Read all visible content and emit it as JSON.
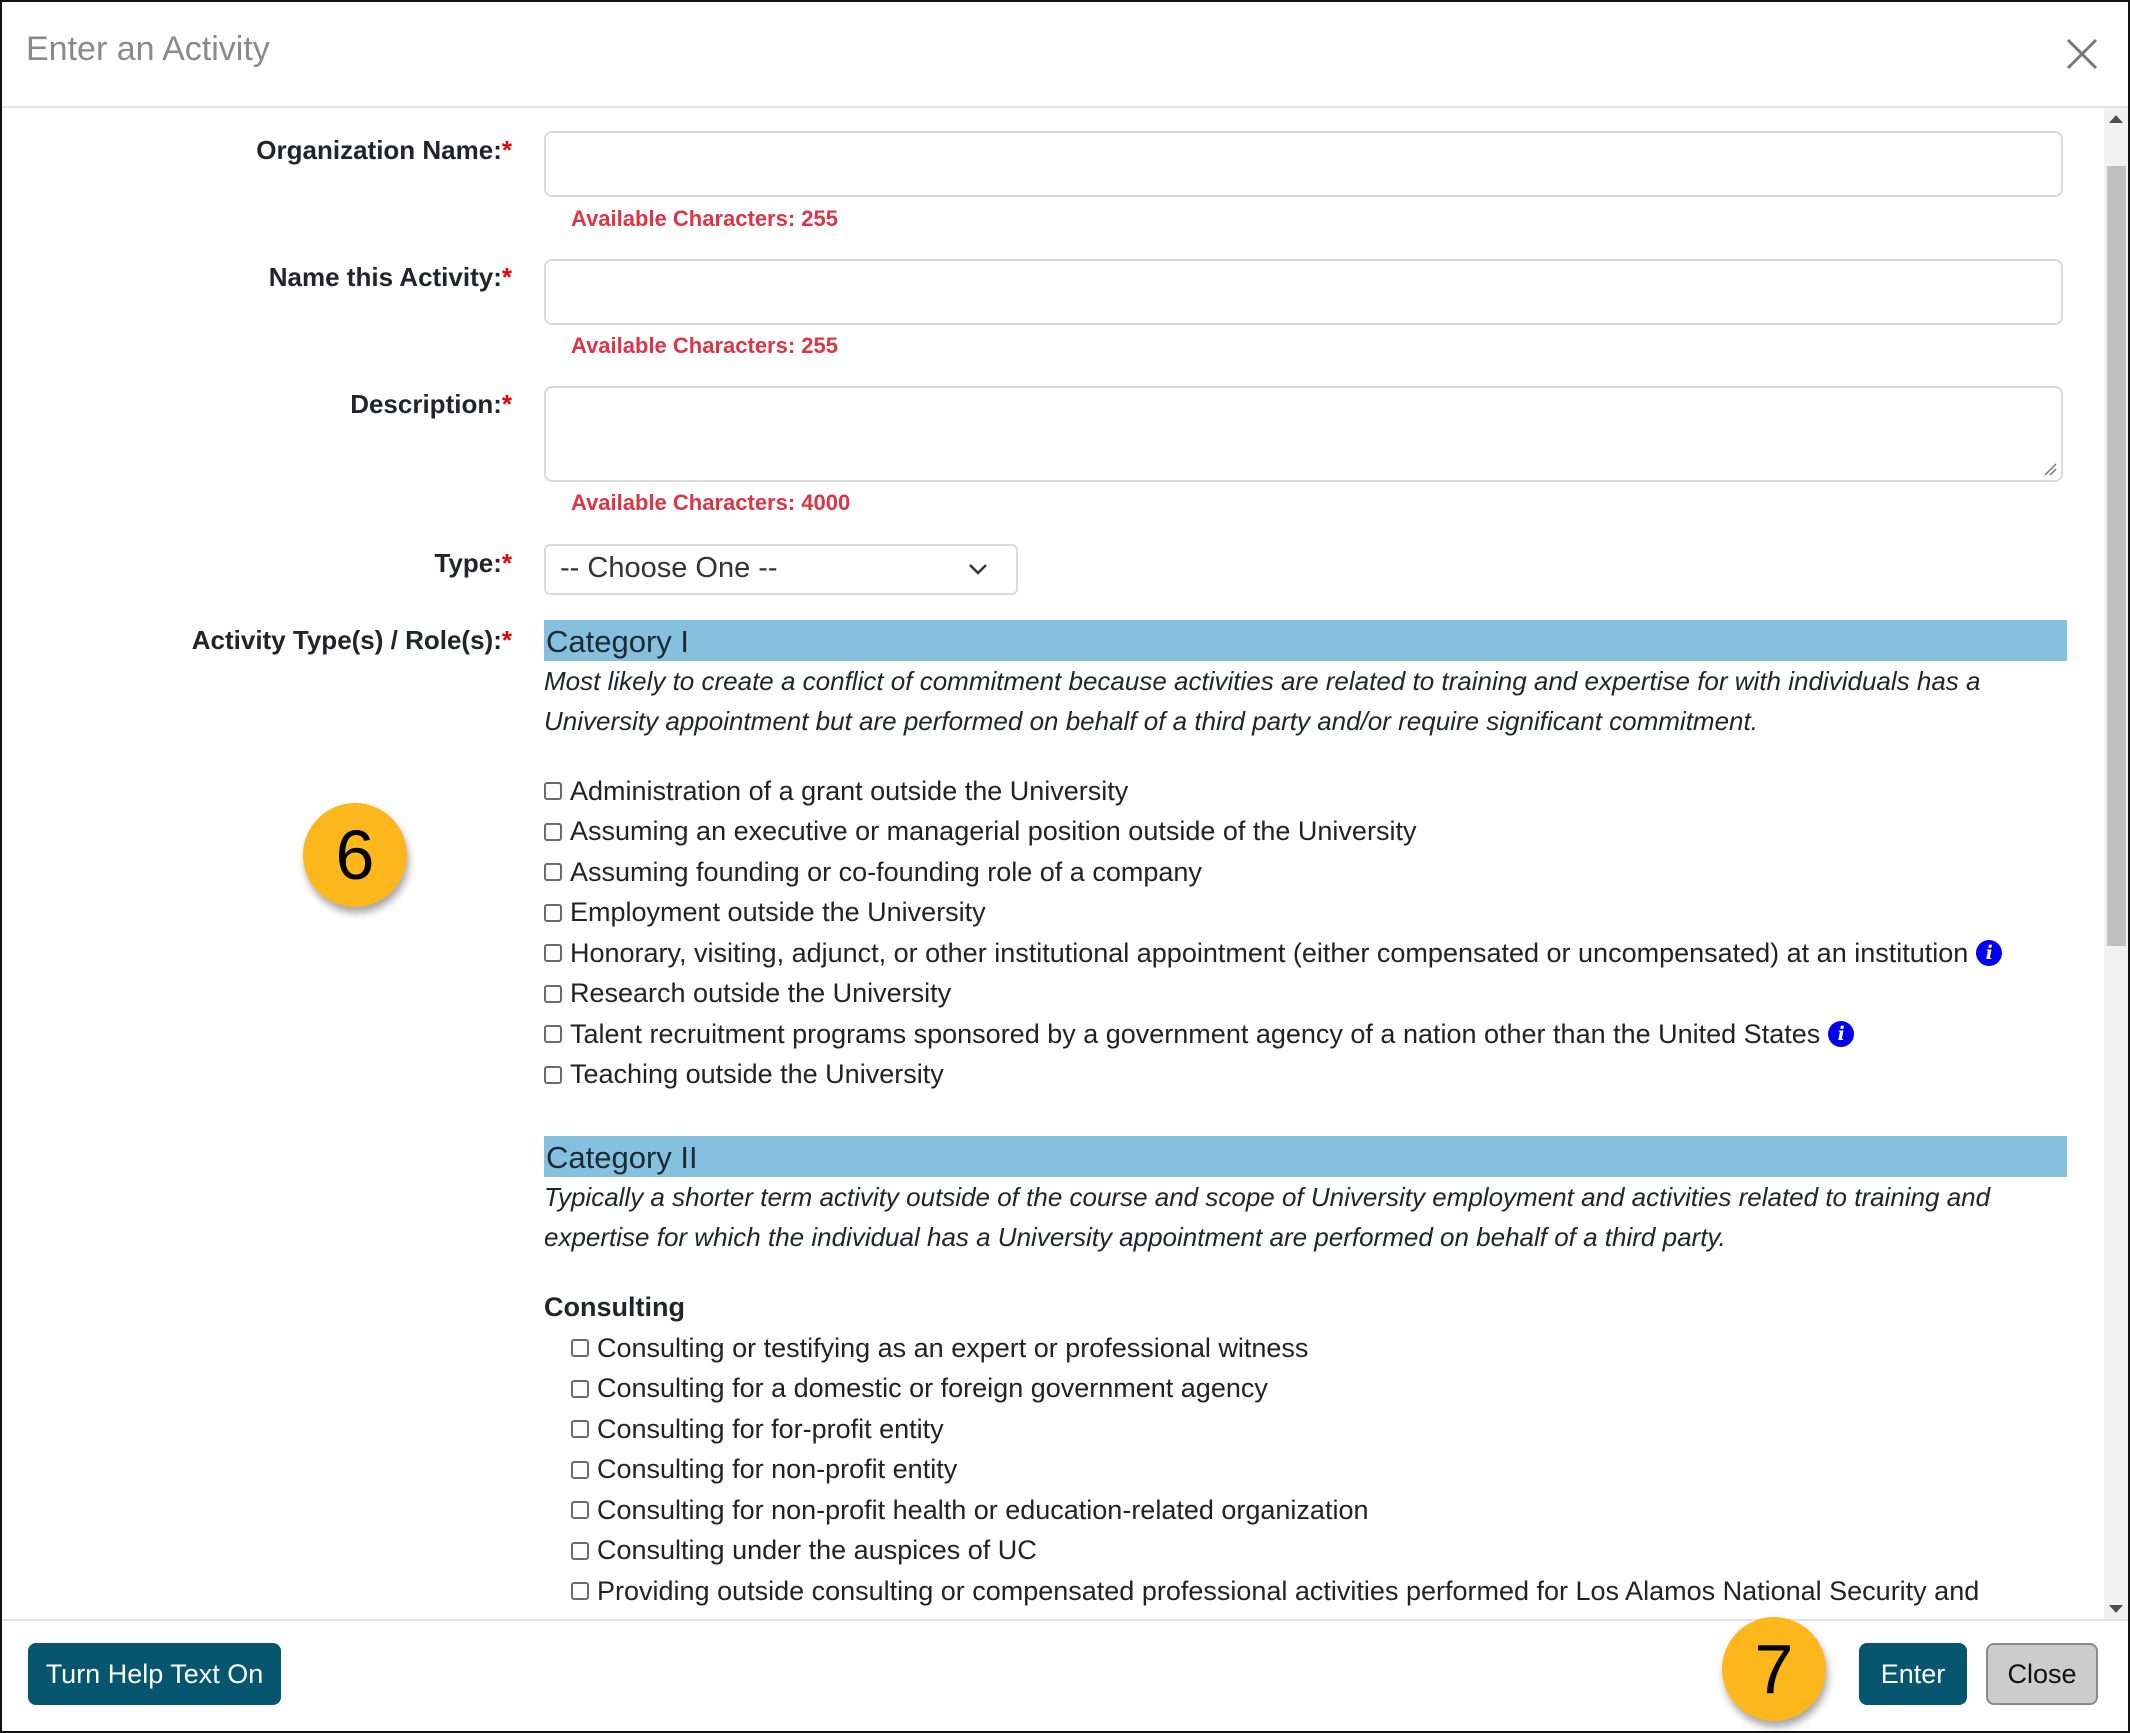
{
  "modal": {
    "title": "Enter an Activity",
    "close_icon": "close-x-icon"
  },
  "form": {
    "required_marker": "*",
    "organization": {
      "label": "Organization Name:",
      "value": "",
      "available": "Available Characters: 255"
    },
    "activity_name": {
      "label": "Name this Activity:",
      "value": "",
      "available": "Available Characters: 255"
    },
    "description": {
      "label": "Description:",
      "value": "",
      "available": "Available Characters: 4000"
    },
    "type": {
      "label": "Type:",
      "selected": "-- Choose One --"
    },
    "roles_label": "Activity Type(s) / Role(s):"
  },
  "category1": {
    "title": "Category I",
    "description": "Most likely to create a conflict of commitment because activities are related to training and expertise for with individuals has a University appointment but are performed on behalf of a third party and/or require significant commitment.",
    "items": [
      {
        "label": "Administration of a grant outside the University",
        "checked": false,
        "info": false
      },
      {
        "label": "Assuming an executive or managerial position outside of the University",
        "checked": false,
        "info": false
      },
      {
        "label": "Assuming founding or co-founding role of a company",
        "checked": false,
        "info": false
      },
      {
        "label": "Employment outside the University",
        "checked": false,
        "info": false
      },
      {
        "label": "Honorary, visiting, adjunct, or other institutional appointment (either compensated or uncompensated) at an institution",
        "checked": false,
        "info": true
      },
      {
        "label": "Research outside the University",
        "checked": false,
        "info": false
      },
      {
        "label": "Talent recruitment programs sponsored by a government agency of a nation other than the United States",
        "checked": false,
        "info": true
      },
      {
        "label": "Teaching outside the University",
        "checked": false,
        "info": false
      }
    ]
  },
  "category2": {
    "title": "Category II",
    "description": "Typically a shorter term activity outside of the course and scope of University employment and activities related to training and expertise for which the individual has a University appointment are performed on behalf of a third party.",
    "subheading": "Consulting",
    "items": [
      {
        "label": "Consulting or testifying as an expert or professional witness",
        "checked": false
      },
      {
        "label": "Consulting for a domestic or foreign government agency",
        "checked": false
      },
      {
        "label": "Consulting for for-profit entity",
        "checked": false
      },
      {
        "label": "Consulting for non-profit entity",
        "checked": false
      },
      {
        "label": "Consulting for non-profit health or education-related organization",
        "checked": false
      },
      {
        "label": "Consulting under the auspices of UC",
        "checked": false
      },
      {
        "label": "Providing outside consulting or compensated professional activities performed for Los Alamos National Security and",
        "checked": false
      }
    ]
  },
  "info_glyph": "i",
  "footer": {
    "help_button": "Turn Help Text On",
    "enter_button": "Enter",
    "close_button": "Close"
  },
  "annotations": {
    "badge_6": "6",
    "badge_7": "7"
  },
  "colors": {
    "primary": "#05566e",
    "category_bar": "#85c1de",
    "error": "#dc3545",
    "badge": "#fdb71d",
    "info": "#0000ee"
  }
}
